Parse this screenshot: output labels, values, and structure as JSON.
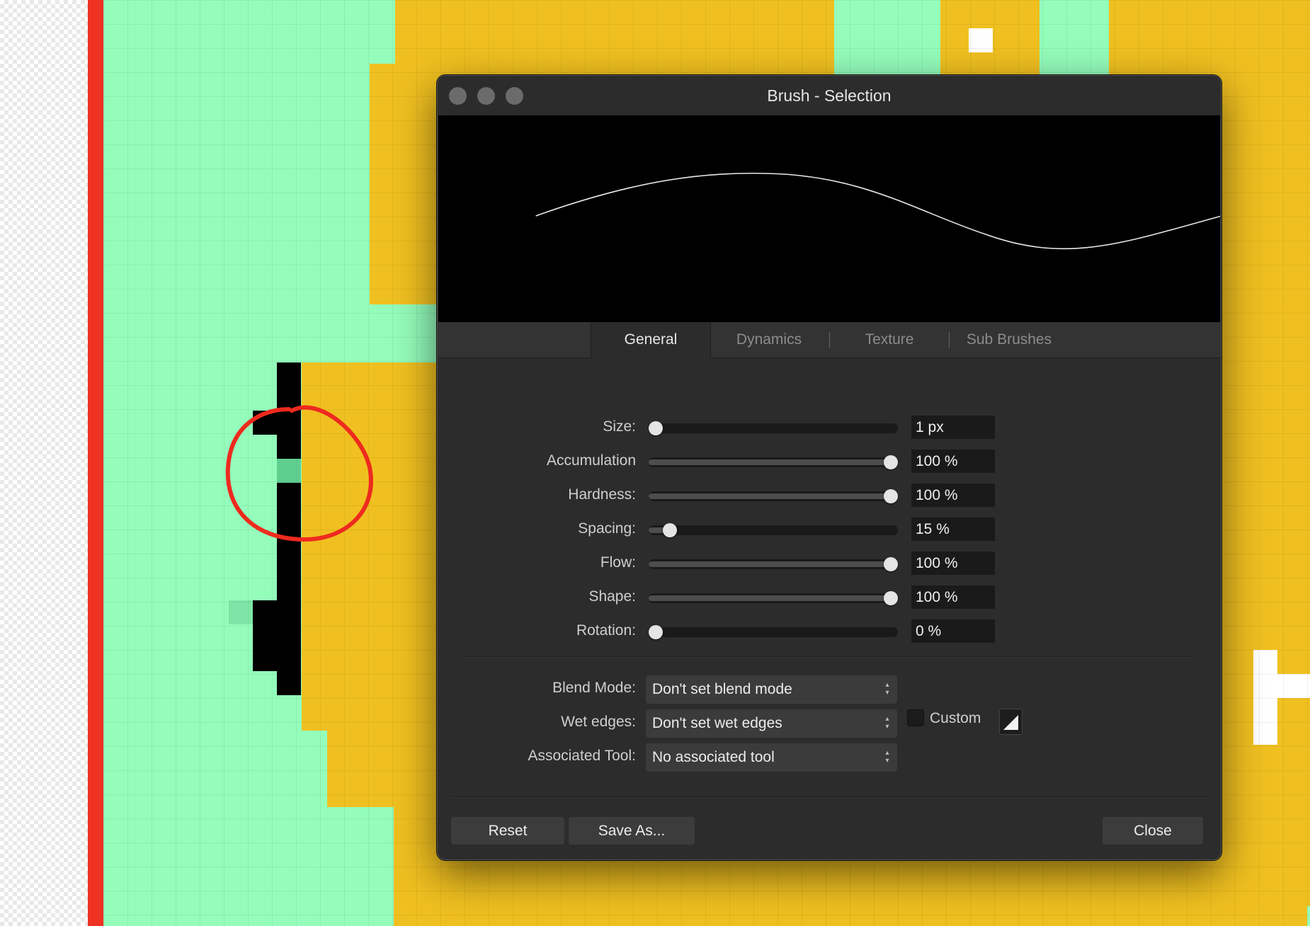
{
  "window": {
    "title": "Brush - Selection"
  },
  "tabs": [
    {
      "label": "General",
      "active": true
    },
    {
      "label": "Dynamics",
      "active": false
    },
    {
      "label": "Texture",
      "active": false
    },
    {
      "label": "Sub Brushes",
      "active": false
    }
  ],
  "sliders": [
    {
      "label": "Size:",
      "value": "1 px",
      "fraction": 0.0
    },
    {
      "label": "Accumulation",
      "value": "100 %",
      "fraction": 1.0
    },
    {
      "label": "Hardness:",
      "value": "100 %",
      "fraction": 1.0
    },
    {
      "label": "Spacing:",
      "value": "15 %",
      "fraction": 0.06
    },
    {
      "label": "Flow:",
      "value": "100 %",
      "fraction": 1.0
    },
    {
      "label": "Shape:",
      "value": "100 %",
      "fraction": 1.0
    },
    {
      "label": "Rotation:",
      "value": "0 %",
      "fraction": 0.0
    }
  ],
  "selects": {
    "blend_mode": {
      "label": "Blend Mode:",
      "value": "Don't set blend mode"
    },
    "wet_edges": {
      "label": "Wet edges:",
      "value": "Don't set wet edges"
    },
    "associated_tool": {
      "label": "Associated Tool:",
      "value": "No associated tool"
    }
  },
  "custom": {
    "label": "Custom",
    "checked": false
  },
  "buttons": {
    "reset": "Reset",
    "save_as": "Save As...",
    "close": "Close"
  },
  "colors": {
    "canvas_green": "#94fdbb",
    "canvas_yellow": "#f0c020",
    "annotation_red": "#ee3323",
    "dialog_bg": "#2c2c2c"
  },
  "icons": {
    "select_arrows": "⌃⌄",
    "pressure_curve": "ramp-curve-icon"
  }
}
